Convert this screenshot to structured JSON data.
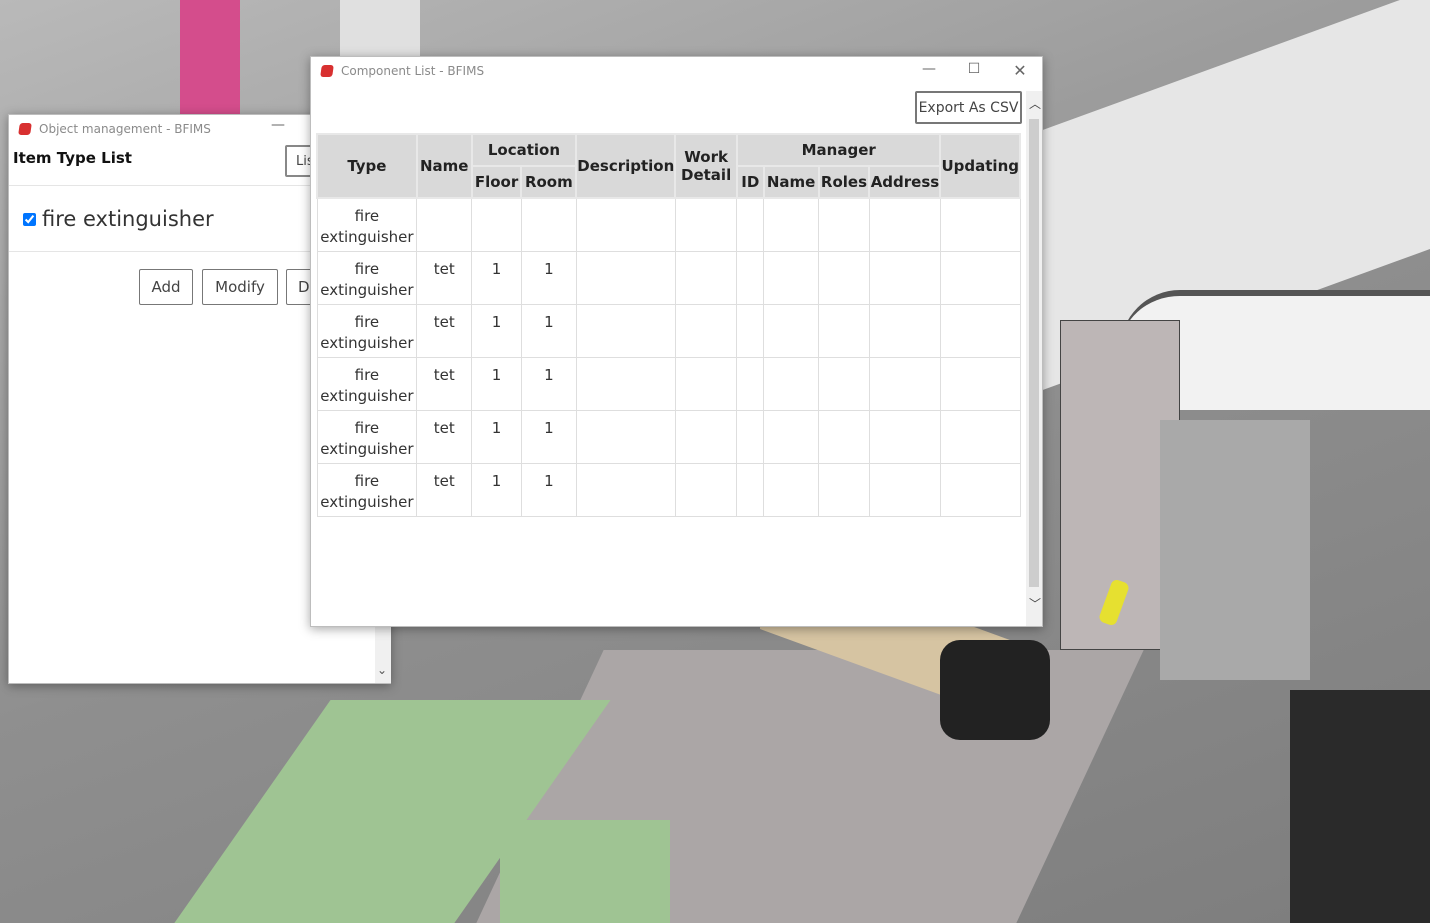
{
  "object_window": {
    "title": "Object management - BFIMS",
    "minimize_icon": "minimize-icon",
    "heading": "Item Type List",
    "list_button": "Lis",
    "item": {
      "label": "fire extinguisher",
      "checked": true
    },
    "buttons": {
      "add": "Add",
      "modify": "Modify",
      "delete": "D"
    }
  },
  "component_window": {
    "title": "Component List - BFIMS",
    "export_button": "Export As CSV",
    "headers": {
      "type": "Type",
      "name": "Name",
      "location": "Location",
      "floor": "Floor",
      "room": "Room",
      "description": "Description",
      "work_detail": "Work Detail",
      "manager": "Manager",
      "id": "ID",
      "manager_name": "Name",
      "roles": "Roles",
      "address": "Address",
      "updating": "Updating"
    },
    "rows": [
      {
        "type": "fire extinguisher",
        "name": "",
        "floor": "",
        "room": ""
      },
      {
        "type": "fire extinguisher",
        "name": "tet",
        "floor": "1",
        "room": "1"
      },
      {
        "type": "fire extinguisher",
        "name": "tet",
        "floor": "1",
        "room": "1"
      },
      {
        "type": "fire extinguisher",
        "name": "tet",
        "floor": "1",
        "room": "1"
      },
      {
        "type": "fire extinguisher",
        "name": "tet",
        "floor": "1",
        "room": "1"
      },
      {
        "type": "fire extinguisher",
        "name": "tet",
        "floor": "1",
        "room": "1"
      }
    ]
  }
}
